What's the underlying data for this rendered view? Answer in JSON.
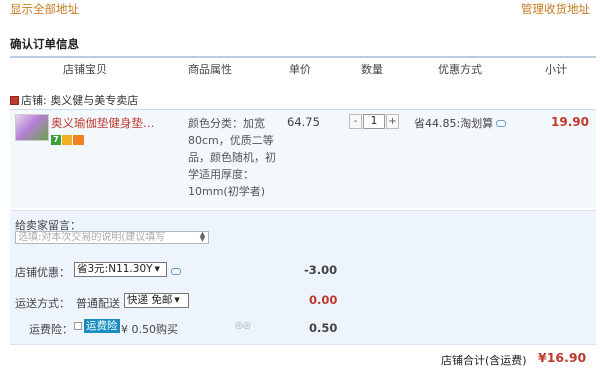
{
  "top_links": {
    "show_all_address": "显示全部地址",
    "manage_address": "管理收货地址"
  },
  "section_title": "确认订单信息",
  "table_headers": [
    "店铺宝贝",
    "商品属性",
    "单价",
    "数量",
    "优惠方式",
    "小计"
  ],
  "shop": {
    "label": "店铺: 奥义健与美专卖店"
  },
  "item": {
    "name": "奥义瑜伽垫健身垫…",
    "badge_number": "7",
    "attributes": "颜色分类：加宽80cm，优质二等品，颜色随机，初学适用厚度：10mm(初学者)",
    "price": "64.75",
    "qty_minus": "-",
    "quantity": "1",
    "qty_plus": "+",
    "discount": "省44.85:淘划算",
    "subtotal": "19.90"
  },
  "options": {
    "memo_label": "给卖家留言：",
    "memo_placeholder": "选填:对本次交易的说明(建议填写",
    "shop_discount_label": "店铺优惠：",
    "shop_discount_value": "省3元:N11.30Y",
    "shop_discount_amount": "-3.00",
    "shipping_label": "运送方式：",
    "shipping_method": "普通配送",
    "shipping_option": "快递 免邮",
    "shipping_amount": "0.00",
    "insurance_label": "运费险：",
    "insurance_tag": "运费险",
    "insurance_text": "¥ 0.50购买",
    "insurance_amount": "0.50"
  },
  "total": {
    "label": "店铺合计(含运费)",
    "value": "¥16.90"
  },
  "colors": {
    "link": "#c47a1f",
    "price_red": "#c0392b",
    "panel_blue": "#eef4fb",
    "header_line": "#b8cde4",
    "insurance_tag": "#1a8cc0"
  }
}
